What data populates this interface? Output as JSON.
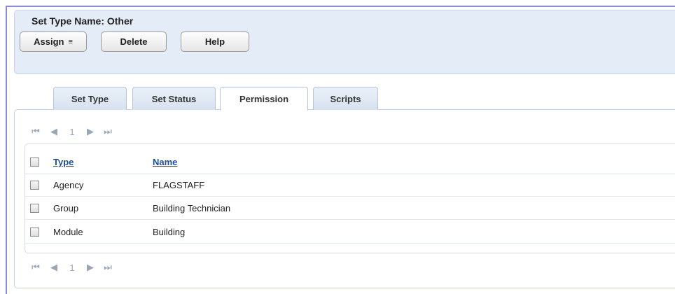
{
  "header": {
    "title": "Set Type Name: Other",
    "buttons": {
      "assign": "Assign",
      "assign_caret": "≡",
      "delete": "Delete",
      "help": "Help"
    }
  },
  "tabs": [
    {
      "label": "Set Type",
      "active": false
    },
    {
      "label": "Set Status",
      "active": false
    },
    {
      "label": "Permission",
      "active": true
    },
    {
      "label": "Scripts",
      "active": false
    }
  ],
  "pager": {
    "first": "⏮",
    "prev": "◀",
    "page": "1",
    "next": "▶",
    "last": "⏭"
  },
  "table": {
    "columns": [
      "Type",
      "Name"
    ],
    "rows": [
      {
        "type": "Agency",
        "name": "FLAGSTAFF"
      },
      {
        "type": "Group",
        "name": "Building Technician"
      },
      {
        "type": "Module",
        "name": "Building"
      }
    ]
  },
  "colors": {
    "header_bg": "#e3ecf7",
    "link": "#1b4f9e",
    "frame": "#8a8ad6"
  }
}
